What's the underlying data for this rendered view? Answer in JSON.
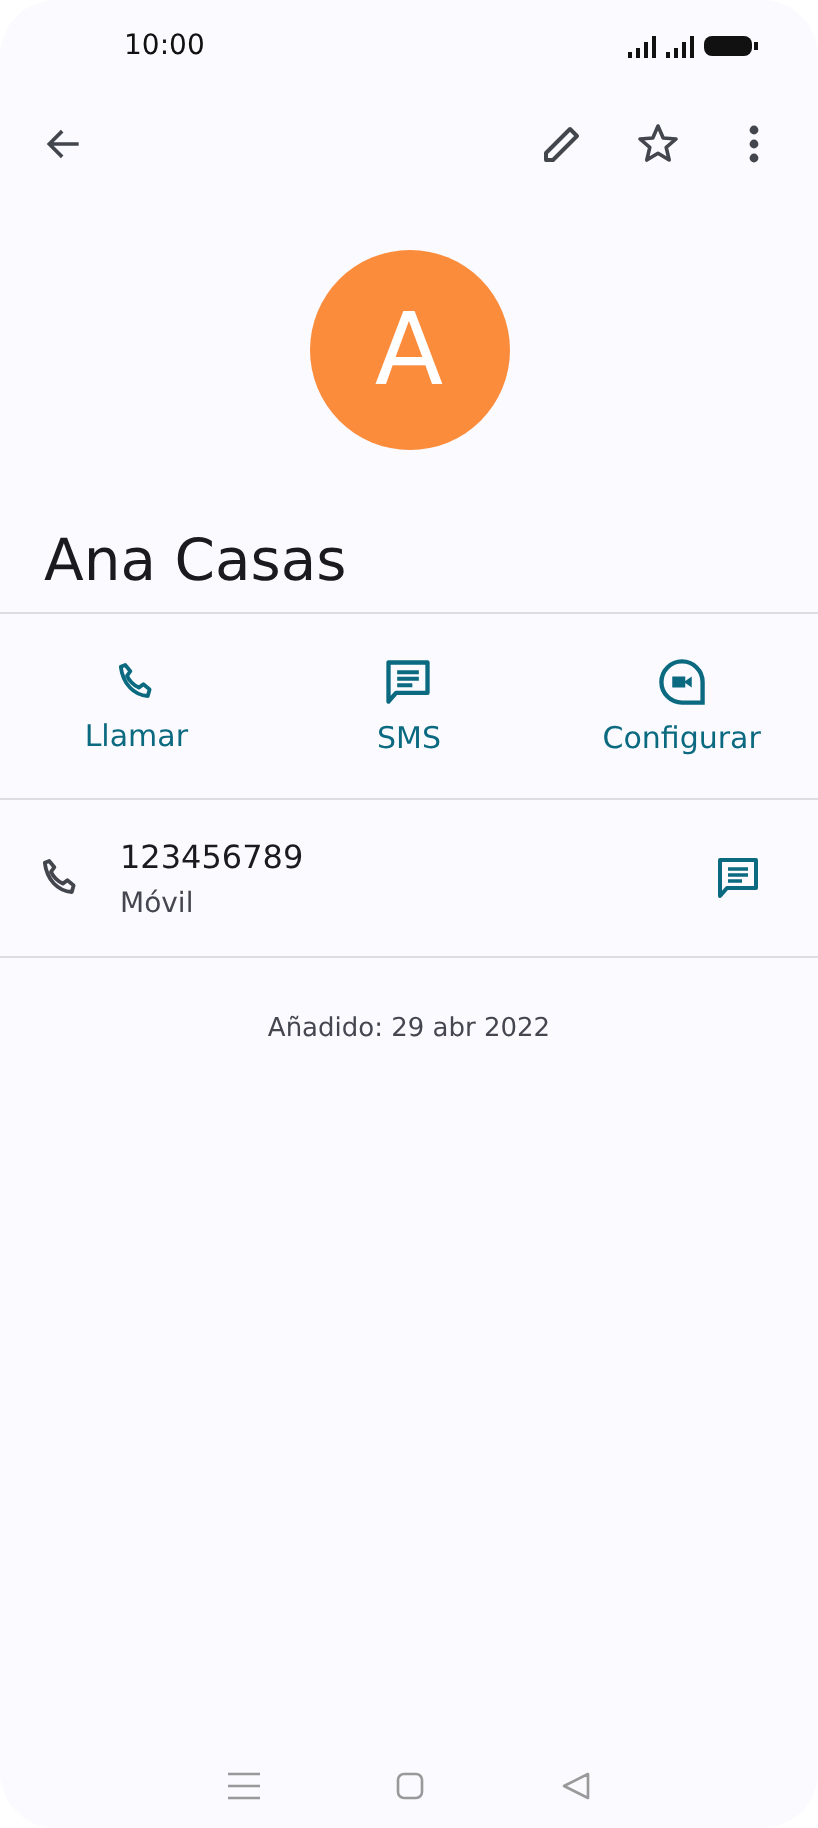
{
  "status_bar": {
    "time": "10:00"
  },
  "contact": {
    "initial": "A",
    "name": "Ana Casas"
  },
  "actions": [
    {
      "kind": "call",
      "label": "Llamar"
    },
    {
      "kind": "sms",
      "label": "SMS"
    },
    {
      "kind": "video",
      "label": "Configurar"
    }
  ],
  "phone": {
    "number": "123456789",
    "type": "Móvil"
  },
  "added": "Añadido: 29 abr 2022"
}
